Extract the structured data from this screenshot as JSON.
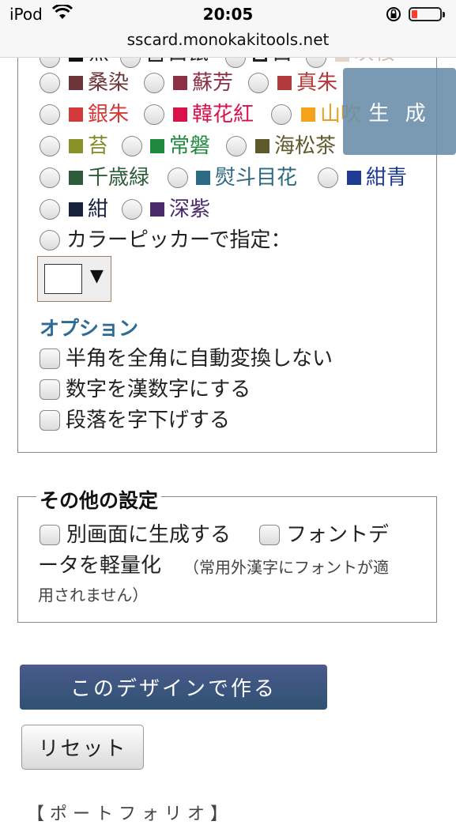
{
  "status_bar": {
    "carrier": "iPod",
    "time": "20:05",
    "url": "sscard.monokakitools.net"
  },
  "colors": {
    "top_row": [
      {
        "name": "黒",
        "color": "#111111"
      },
      {
        "name": "白鼠",
        "color": "#dddddd"
      },
      {
        "name": "白",
        "color": "#ffffff"
      },
      {
        "name": "灰桜",
        "color": "#e8d3c7"
      }
    ],
    "rows": [
      [
        {
          "name": "桑染",
          "color": "#6d3538"
        },
        {
          "name": "蘇芳",
          "color": "#8e3045"
        },
        {
          "name": "真朱",
          "color": "#b33a3a"
        }
      ],
      [
        {
          "name": "銀朱",
          "color": "#d13b3b"
        },
        {
          "name": "韓花紅",
          "color": "#d9134a"
        },
        {
          "name": "山吹",
          "color": "#f5a31a"
        }
      ],
      [
        {
          "name": "苔",
          "color": "#8a9129"
        },
        {
          "name": "常磐",
          "color": "#1f8a3e"
        },
        {
          "name": "海松茶",
          "color": "#5e5a2b"
        }
      ],
      [
        {
          "name": "千歳緑",
          "color": "#2e5c3a"
        },
        {
          "name": "熨斗目花",
          "color": "#2b6a80"
        },
        {
          "name": "紺青",
          "color": "#1f3a93"
        }
      ],
      [
        {
          "name": "紺",
          "color": "#16233f"
        },
        {
          "name": "深紫",
          "color": "#4b2a6b"
        }
      ]
    ],
    "picker_label": "カラーピッカーで指定：",
    "picker_value": "#ffffff"
  },
  "generate_button": "生 成",
  "options": {
    "title": "オプション",
    "items": [
      "半角を全角に自動変換しない",
      "数字を漢数字にする",
      "段落を字下げする"
    ]
  },
  "other_settings": {
    "legend": "その他の設定",
    "separate_window": "別画面に生成する",
    "font_light_line1": "フォントデ",
    "font_light_line2": "ータを軽量化",
    "font_note_part1": "（常用外漢字にフォントが適",
    "font_note_part2": "用されません）"
  },
  "make_button": "このデザインで作る",
  "reset_button": "リセット",
  "footer_peek": "【 ポ ー ト フ ォ リ オ 】"
}
